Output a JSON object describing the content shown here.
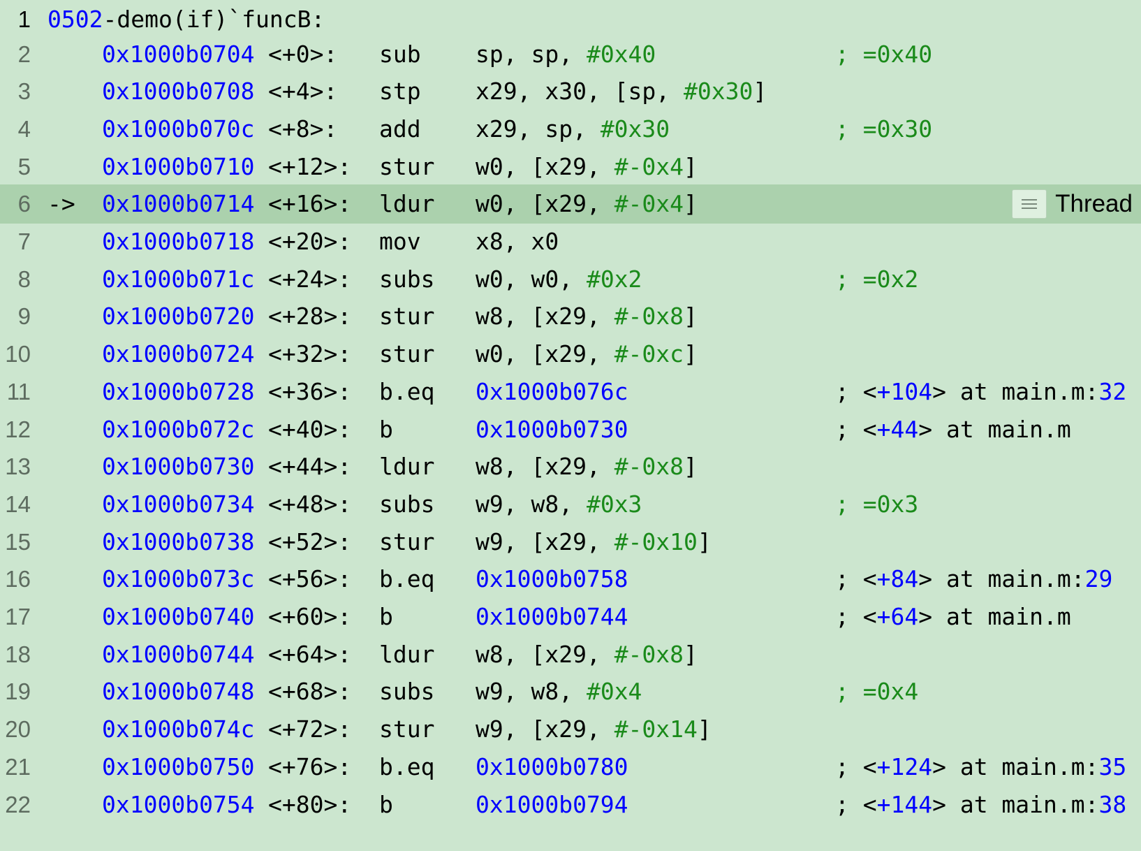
{
  "header": {
    "line_number": "1",
    "prefix": "0502",
    "rest": "-demo(if)`funcB:"
  },
  "current_line_marker": "->",
  "thread_badge": {
    "label": "Thread",
    "menu_icon": "hamburger-menu-icon"
  },
  "colors": {
    "background": "#cce6cf",
    "current_line": "#abd1ad",
    "address": "#0000ff",
    "immediate": "#1a8a1a"
  },
  "lines": [
    {
      "ln": "2",
      "addr": "0x1000b0704",
      "off": "<+0>:",
      "mnem": "sub",
      "ops": [
        {
          "t": "sp, sp, ",
          "c": "black"
        },
        {
          "t": "#0x40",
          "c": "green"
        }
      ],
      "cmt": [
        {
          "t": "; =0x40",
          "c": "green"
        }
      ]
    },
    {
      "ln": "3",
      "addr": "0x1000b0708",
      "off": "<+4>:",
      "mnem": "stp",
      "ops": [
        {
          "t": "x29, x30, [sp, ",
          "c": "black"
        },
        {
          "t": "#0x30",
          "c": "green"
        },
        {
          "t": "]",
          "c": "black"
        }
      ],
      "cmt": []
    },
    {
      "ln": "4",
      "addr": "0x1000b070c",
      "off": "<+8>:",
      "mnem": "add",
      "ops": [
        {
          "t": "x29, sp, ",
          "c": "black"
        },
        {
          "t": "#0x30",
          "c": "green"
        }
      ],
      "cmt": [
        {
          "t": "; =0x30",
          "c": "green"
        }
      ]
    },
    {
      "ln": "5",
      "addr": "0x1000b0710",
      "off": "<+12>:",
      "mnem": "stur",
      "ops": [
        {
          "t": "w0, [x29, ",
          "c": "black"
        },
        {
          "t": "#-0x4",
          "c": "green"
        },
        {
          "t": "]",
          "c": "black"
        }
      ],
      "cmt": []
    },
    {
      "ln": "6",
      "addr": "0x1000b0714",
      "off": "<+16>:",
      "mnem": "ldur",
      "ops": [
        {
          "t": "w0, [x29, ",
          "c": "black"
        },
        {
          "t": "#-0x4",
          "c": "green"
        },
        {
          "t": "]",
          "c": "black"
        }
      ],
      "cmt": [],
      "current": true
    },
    {
      "ln": "7",
      "addr": "0x1000b0718",
      "off": "<+20>:",
      "mnem": "mov",
      "ops": [
        {
          "t": "x8, x0",
          "c": "black"
        }
      ],
      "cmt": []
    },
    {
      "ln": "8",
      "addr": "0x1000b071c",
      "off": "<+24>:",
      "mnem": "subs",
      "ops": [
        {
          "t": "w0, w0, ",
          "c": "black"
        },
        {
          "t": "#0x2",
          "c": "green"
        }
      ],
      "cmt": [
        {
          "t": "; =0x2",
          "c": "green"
        }
      ]
    },
    {
      "ln": "9",
      "addr": "0x1000b0720",
      "off": "<+28>:",
      "mnem": "stur",
      "ops": [
        {
          "t": "w8, [x29, ",
          "c": "black"
        },
        {
          "t": "#-0x8",
          "c": "green"
        },
        {
          "t": "]",
          "c": "black"
        }
      ],
      "cmt": []
    },
    {
      "ln": "10",
      "addr": "0x1000b0724",
      "off": "<+32>:",
      "mnem": "stur",
      "ops": [
        {
          "t": "w0, [x29, ",
          "c": "black"
        },
        {
          "t": "#-0xc",
          "c": "green"
        },
        {
          "t": "]",
          "c": "black"
        }
      ],
      "cmt": []
    },
    {
      "ln": "11",
      "addr": "0x1000b0728",
      "off": "<+36>:",
      "mnem": "b.eq",
      "ops": [
        {
          "t": "0x1000b076c",
          "c": "blue"
        }
      ],
      "cmt": [
        {
          "t": "; <",
          "c": "black"
        },
        {
          "t": "+104",
          "c": "blue"
        },
        {
          "t": "> at main.m:",
          "c": "black"
        },
        {
          "t": "32",
          "c": "blue"
        }
      ]
    },
    {
      "ln": "12",
      "addr": "0x1000b072c",
      "off": "<+40>:",
      "mnem": "b",
      "ops": [
        {
          "t": "0x1000b0730",
          "c": "blue"
        }
      ],
      "cmt": [
        {
          "t": "; <",
          "c": "black"
        },
        {
          "t": "+44",
          "c": "blue"
        },
        {
          "t": "> at main.m",
          "c": "black"
        }
      ]
    },
    {
      "ln": "13",
      "addr": "0x1000b0730",
      "off": "<+44>:",
      "mnem": "ldur",
      "ops": [
        {
          "t": "w8, [x29, ",
          "c": "black"
        },
        {
          "t": "#-0x8",
          "c": "green"
        },
        {
          "t": "]",
          "c": "black"
        }
      ],
      "cmt": []
    },
    {
      "ln": "14",
      "addr": "0x1000b0734",
      "off": "<+48>:",
      "mnem": "subs",
      "ops": [
        {
          "t": "w9, w8, ",
          "c": "black"
        },
        {
          "t": "#0x3",
          "c": "green"
        }
      ],
      "cmt": [
        {
          "t": "; =0x3",
          "c": "green"
        }
      ]
    },
    {
      "ln": "15",
      "addr": "0x1000b0738",
      "off": "<+52>:",
      "mnem": "stur",
      "ops": [
        {
          "t": "w9, [x29, ",
          "c": "black"
        },
        {
          "t": "#-0x10",
          "c": "green"
        },
        {
          "t": "]",
          "c": "black"
        }
      ],
      "cmt": []
    },
    {
      "ln": "16",
      "addr": "0x1000b073c",
      "off": "<+56>:",
      "mnem": "b.eq",
      "ops": [
        {
          "t": "0x1000b0758",
          "c": "blue"
        }
      ],
      "cmt": [
        {
          "t": "; <",
          "c": "black"
        },
        {
          "t": "+84",
          "c": "blue"
        },
        {
          "t": "> at main.m:",
          "c": "black"
        },
        {
          "t": "29",
          "c": "blue"
        }
      ]
    },
    {
      "ln": "17",
      "addr": "0x1000b0740",
      "off": "<+60>:",
      "mnem": "b",
      "ops": [
        {
          "t": "0x1000b0744",
          "c": "blue"
        }
      ],
      "cmt": [
        {
          "t": "; <",
          "c": "black"
        },
        {
          "t": "+64",
          "c": "blue"
        },
        {
          "t": "> at main.m",
          "c": "black"
        }
      ]
    },
    {
      "ln": "18",
      "addr": "0x1000b0744",
      "off": "<+64>:",
      "mnem": "ldur",
      "ops": [
        {
          "t": "w8, [x29, ",
          "c": "black"
        },
        {
          "t": "#-0x8",
          "c": "green"
        },
        {
          "t": "]",
          "c": "black"
        }
      ],
      "cmt": []
    },
    {
      "ln": "19",
      "addr": "0x1000b0748",
      "off": "<+68>:",
      "mnem": "subs",
      "ops": [
        {
          "t": "w9, w8, ",
          "c": "black"
        },
        {
          "t": "#0x4",
          "c": "green"
        }
      ],
      "cmt": [
        {
          "t": "; =0x4",
          "c": "green"
        }
      ]
    },
    {
      "ln": "20",
      "addr": "0x1000b074c",
      "off": "<+72>:",
      "mnem": "stur",
      "ops": [
        {
          "t": "w9, [x29, ",
          "c": "black"
        },
        {
          "t": "#-0x14",
          "c": "green"
        },
        {
          "t": "]",
          "c": "black"
        }
      ],
      "cmt": []
    },
    {
      "ln": "21",
      "addr": "0x1000b0750",
      "off": "<+76>:",
      "mnem": "b.eq",
      "ops": [
        {
          "t": "0x1000b0780",
          "c": "blue"
        }
      ],
      "cmt": [
        {
          "t": "; <",
          "c": "black"
        },
        {
          "t": "+124",
          "c": "blue"
        },
        {
          "t": "> at main.m:",
          "c": "black"
        },
        {
          "t": "35",
          "c": "blue"
        }
      ]
    },
    {
      "ln": "22",
      "addr": "0x1000b0754",
      "off": "<+80>:",
      "mnem": "b",
      "ops": [
        {
          "t": "0x1000b0794",
          "c": "blue"
        }
      ],
      "cmt": [
        {
          "t": "; <",
          "c": "black"
        },
        {
          "t": "+144",
          "c": "blue"
        },
        {
          "t": "> at main.m:",
          "c": "black"
        },
        {
          "t": "38",
          "c": "blue"
        }
      ]
    }
  ]
}
